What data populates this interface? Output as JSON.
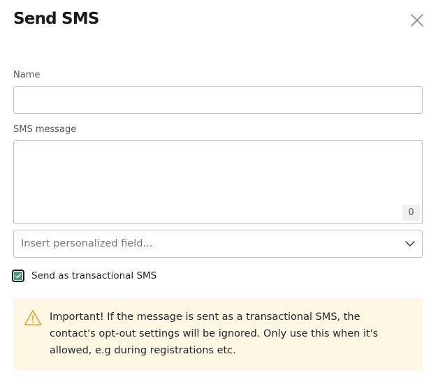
{
  "dialog": {
    "title": "Send SMS",
    "close_icon": "close-icon"
  },
  "form": {
    "name": {
      "label": "Name",
      "value": "",
      "placeholder": ""
    },
    "sms_message": {
      "label": "SMS message",
      "value": "",
      "char_count": "0"
    },
    "personalized_field": {
      "placeholder": "Insert personalized field...",
      "chevron_icon": "chevron-down-icon"
    },
    "transactional": {
      "label": "Send as transactional SMS",
      "checked": true,
      "color": "#4a9a7c"
    }
  },
  "warning": {
    "icon": "warning-icon",
    "text": "Important! If the message is sent as a transactional SMS, the contact's opt-out settings will be ignored. Only use this when it's allowed, e.g during registrations etc.",
    "background": "#fdf7e4",
    "icon_color": "#e0a72b"
  }
}
